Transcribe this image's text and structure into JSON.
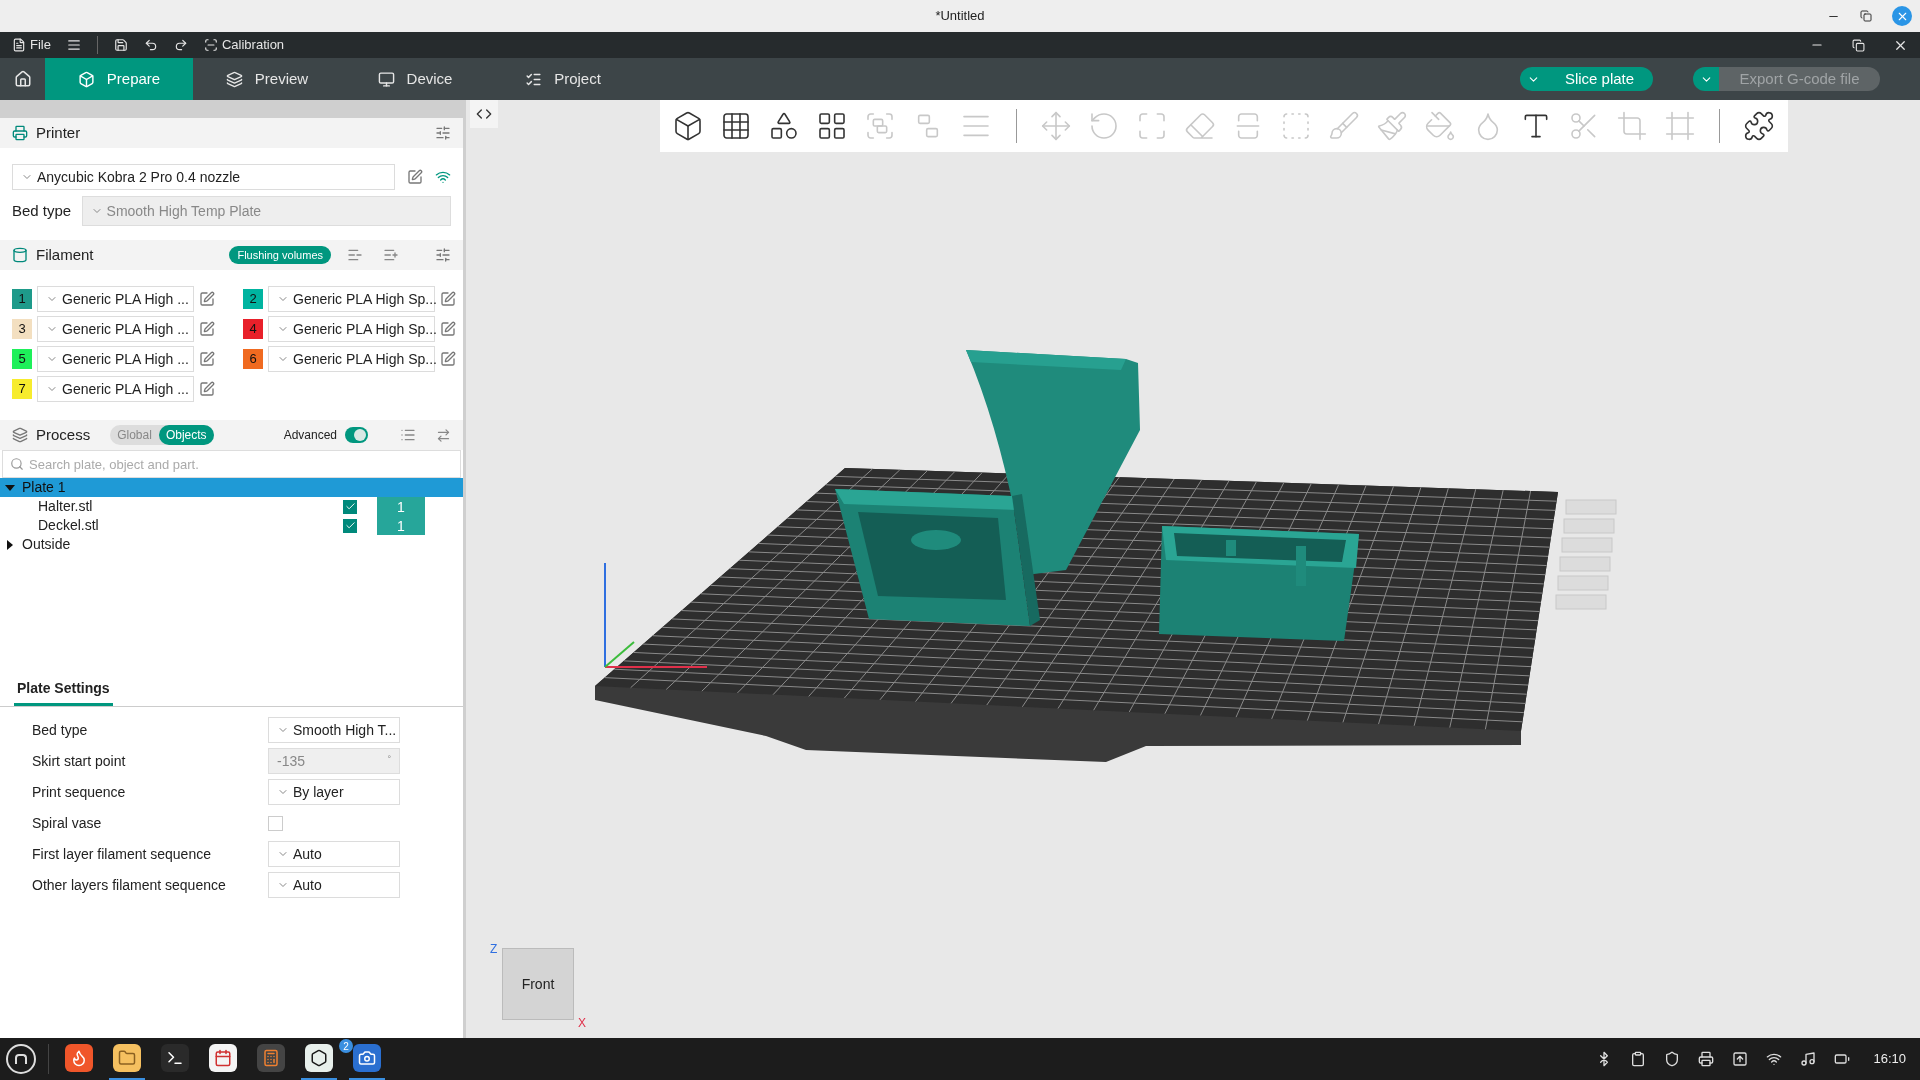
{
  "window": {
    "title": "*Untitled"
  },
  "menu_bar": {
    "file": "File",
    "calibration": "Calibration"
  },
  "tabs": [
    {
      "label": "Prepare",
      "selected": true
    },
    {
      "label": "Preview",
      "selected": false
    },
    {
      "label": "Device",
      "selected": false
    },
    {
      "label": "Project",
      "selected": false
    }
  ],
  "actions": [
    {
      "label": "Slice plate",
      "disabled": false
    },
    {
      "label": "Export G-code file",
      "disabled": true
    }
  ],
  "toolbar": [
    {
      "kind": "tool",
      "disabled": false
    },
    {
      "kind": "tool",
      "disabled": false
    },
    {
      "kind": "tool",
      "disabled": false
    },
    {
      "kind": "tool",
      "disabled": false
    },
    {
      "kind": "tool",
      "disabled": true
    },
    {
      "kind": "tool",
      "disabled": true
    },
    {
      "kind": "tool",
      "disabled": true
    },
    {
      "kind": "separator"
    },
    {
      "kind": "tool",
      "disabled": true
    },
    {
      "kind": "tool",
      "disabled": true
    },
    {
      "kind": "tool",
      "disabled": true
    },
    {
      "kind": "tool",
      "disabled": true
    },
    {
      "kind": "tool",
      "disabled": true
    },
    {
      "kind": "tool",
      "disabled": true
    },
    {
      "kind": "tool",
      "disabled": true
    },
    {
      "kind": "tool",
      "disabled": true
    },
    {
      "kind": "tool",
      "disabled": true
    },
    {
      "kind": "tool",
      "disabled": true
    },
    {
      "kind": "tool",
      "disabled": false
    },
    {
      "kind": "tool",
      "disabled": true
    },
    {
      "kind": "tool",
      "disabled": true
    },
    {
      "kind": "tool",
      "disabled": true
    },
    {
      "kind": "separator"
    },
    {
      "kind": "tool",
      "disabled": false
    }
  ],
  "printer": {
    "title": "Printer",
    "preset": "Anycubic Kobra 2 Pro 0.4 nozzle",
    "bed_type_label": "Bed type",
    "bed_type": "Smooth High Temp Plate"
  },
  "filament": {
    "title": "Filament",
    "flushing": "Flushing volumes",
    "slots": [
      {
        "number": "1",
        "color": "#1e9a8a",
        "name": "Generic PLA High ..."
      },
      {
        "number": "2",
        "color": "#00b4a0",
        "name": "Generic PLA High Sp..."
      },
      {
        "number": "3",
        "color": "#f3dfc0",
        "name": "Generic PLA High ..."
      },
      {
        "number": "4",
        "color": "#e8202a",
        "name": "Generic PLA High Sp..."
      },
      {
        "number": "5",
        "color": "#1ef05a",
        "name": "Generic PLA High ..."
      },
      {
        "number": "6",
        "color": "#f06a20",
        "name": "Generic PLA High Sp..."
      },
      {
        "number": "7",
        "color": "#f7ec2d",
        "name": "Generic PLA High ..."
      }
    ]
  },
  "process": {
    "title": "Process",
    "scopes": [
      {
        "label": "Global",
        "selected": false
      },
      {
        "label": "Objects",
        "selected": true
      }
    ],
    "advanced_label": "Advanced",
    "advanced": true,
    "search_placeholder": "Search plate, object and part.",
    "tree": [
      {
        "label": "Plate 1",
        "expanded": true,
        "selected": true,
        "children": [
          {
            "label": "Halter.stl",
            "checked": true,
            "count": "1"
          },
          {
            "label": "Deckel.stl",
            "checked": true,
            "count": "1"
          }
        ]
      },
      {
        "label": "Outside",
        "expanded": false,
        "selected": false
      }
    ]
  },
  "plate_settings": {
    "tab": "Plate Settings",
    "rows": [
      {
        "kind": "select",
        "label": "Bed type",
        "value": "Smooth High T..."
      },
      {
        "kind": "number",
        "label": "Skirt start point",
        "value": "-135",
        "unit": "°"
      },
      {
        "kind": "select",
        "label": "Print sequence",
        "value": "By layer"
      },
      {
        "kind": "checkbox",
        "label": "Spiral vase",
        "checked": false
      },
      {
        "kind": "select",
        "label": "First layer filament sequence",
        "value": "Auto"
      },
      {
        "kind": "select",
        "label": "Other layers filament sequence",
        "value": "Auto"
      }
    ]
  },
  "viewport": {
    "nav_cube": {
      "face": "Front",
      "axis_z": "Z",
      "axis_x": "X"
    }
  },
  "taskbar": {
    "apps": [
      {
        "running": false
      },
      {
        "running": true
      },
      {
        "running": false
      },
      {
        "running": false
      },
      {
        "running": false
      },
      {
        "running": true
      },
      {
        "running": true
      }
    ],
    "badge": "2",
    "clock": "16:10"
  }
}
